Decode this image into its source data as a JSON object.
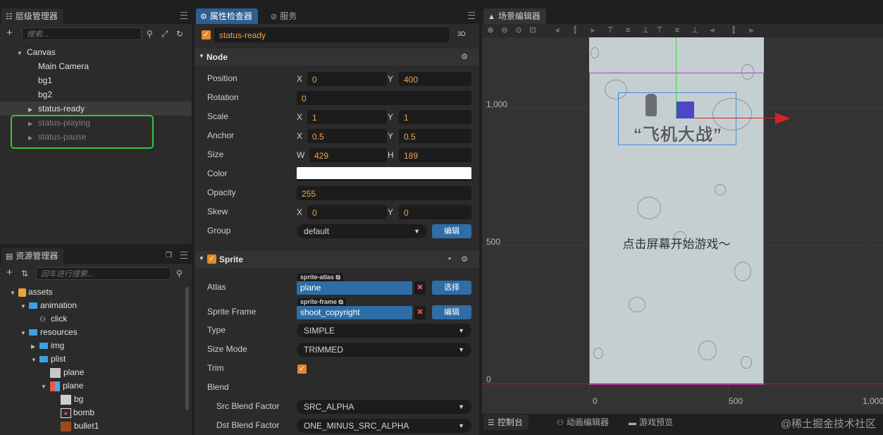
{
  "hierarchy": {
    "tab": "层级管理器",
    "search_placeholder": "搜索...",
    "nodes": [
      {
        "label": "Canvas",
        "depth": 0,
        "expanded": true
      },
      {
        "label": "Main Camera",
        "depth": 1
      },
      {
        "label": "bg1",
        "depth": 1
      },
      {
        "label": "bg2",
        "depth": 1
      },
      {
        "label": "status-ready",
        "depth": 1,
        "collapsed": true,
        "selected": true
      },
      {
        "label": "status-playing",
        "depth": 1,
        "collapsed": true,
        "dimmed": true
      },
      {
        "label": "status-pause",
        "depth": 1,
        "collapsed": true,
        "dimmed": true
      }
    ],
    "highlight_color": "#35c63a"
  },
  "assets": {
    "tab": "资源管理器",
    "search_placeholder": "回车进行搜索...",
    "items": [
      {
        "label": "assets",
        "icon": "assets-db-icon"
      },
      {
        "label": "animation",
        "icon": "folder-icon"
      },
      {
        "label": "click",
        "icon": "animation-clip-icon"
      },
      {
        "label": "resources",
        "icon": "folder-icon"
      },
      {
        "label": "img",
        "icon": "folder-icon"
      },
      {
        "label": "plist",
        "icon": "folder-icon"
      },
      {
        "label": "plane",
        "icon": "texture-icon"
      },
      {
        "label": "plane",
        "icon": "atlas-icon"
      },
      {
        "label": "bg",
        "icon": "sprite-frame-icon"
      },
      {
        "label": "bomb",
        "icon": "sprite-frame-icon"
      },
      {
        "label": "bullet1",
        "icon": "sprite-frame-icon"
      }
    ]
  },
  "inspector": {
    "tab_active": "属性检查器",
    "tab_inactive": "服务",
    "node_name": "status-ready",
    "mode": "3D",
    "node_section": "Node",
    "position": {
      "label": "Position",
      "x_label": "X",
      "x": "0",
      "y_label": "Y",
      "y": "400"
    },
    "rotation": {
      "label": "Rotation",
      "value": "0"
    },
    "scale": {
      "label": "Scale",
      "x_label": "X",
      "x": "1",
      "y_label": "Y",
      "y": "1"
    },
    "anchor": {
      "label": "Anchor",
      "x_label": "X",
      "x": "0.5",
      "y_label": "Y",
      "y": "0.5"
    },
    "size": {
      "label": "Size",
      "w_label": "W",
      "w": "429",
      "h_label": "H",
      "h": "189"
    },
    "color": {
      "label": "Color",
      "value": "#ffffff"
    },
    "opacity": {
      "label": "Opacity",
      "value": "255"
    },
    "skew": {
      "label": "Skew",
      "x_label": "X",
      "x": "0",
      "y_label": "Y",
      "y": "0"
    },
    "group": {
      "label": "Group",
      "value": "default",
      "edit": "编辑"
    },
    "sprite_section": "Sprite",
    "atlas": {
      "label": "Atlas",
      "tag": "sprite-atlas",
      "value": "plane",
      "button": "选择"
    },
    "sprite_frame": {
      "label": "Sprite Frame",
      "tag": "sprite-frame",
      "value": "shoot_copyright",
      "button": "编辑"
    },
    "type": {
      "label": "Type",
      "value": "SIMPLE"
    },
    "size_mode": {
      "label": "Size Mode",
      "value": "TRIMMED"
    },
    "trim": {
      "label": "Trim",
      "checked": true
    },
    "blend": {
      "label": "Blend"
    },
    "src_blend": {
      "label": "Src Blend Factor",
      "value": "SRC_ALPHA"
    },
    "dst_blend": {
      "label": "Dst Blend Factor",
      "value": "ONE_MINUS_SRC_ALPHA"
    }
  },
  "scene": {
    "tab": "场景编辑器",
    "ruler_y": [
      "1,000",
      "500",
      "0"
    ],
    "ruler_x": [
      "0",
      "500",
      "1,000"
    ],
    "game_title": "“飞机大战”",
    "prompt": "点击屏幕开始游戏～",
    "bottom_tabs": [
      "控制台",
      "动画编辑器",
      "游戏预览"
    ],
    "watermark": "@稀土掘金技术社区",
    "canvas_color": "#c5cfd2",
    "frame_color": "#c23ac3",
    "selection_color": "#3e8fd8"
  }
}
